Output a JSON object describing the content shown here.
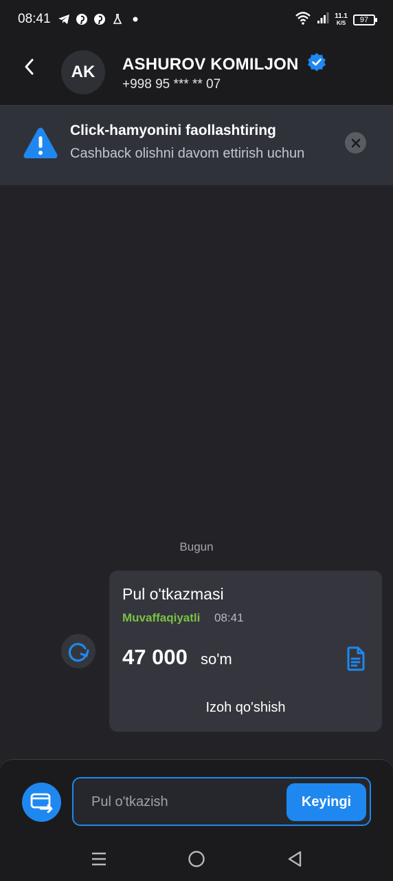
{
  "status_bar": {
    "time": "08:41",
    "icons": [
      "telegram-icon",
      "pinterest-icon",
      "pinterest-icon",
      "flask-icon",
      "dot-icon"
    ],
    "net_speed_value": "11.1",
    "net_speed_unit": "K/S",
    "battery": "97"
  },
  "header": {
    "avatar_initials": "AK",
    "name": "ASHUROV KOMILJON",
    "phone": "+998 95 *** ** 07"
  },
  "banner": {
    "title": "Click-hamyonini faollashtiring",
    "subtitle": "Cashback olishni davom ettirish uchun"
  },
  "chat": {
    "date_label": "Bugun",
    "transfer": {
      "title": "Pul o'tkazmasi",
      "status": "Muvaffaqiyatli",
      "time": "08:41",
      "amount": "47 000",
      "currency": "so'm",
      "comment_label": "Izoh qo'shish"
    }
  },
  "composer": {
    "placeholder": "Pul o'tkazish",
    "value": "",
    "next_label": "Keyingi"
  },
  "colors": {
    "accent": "#1e88f0",
    "success": "#7ac143",
    "background": "#232327"
  }
}
